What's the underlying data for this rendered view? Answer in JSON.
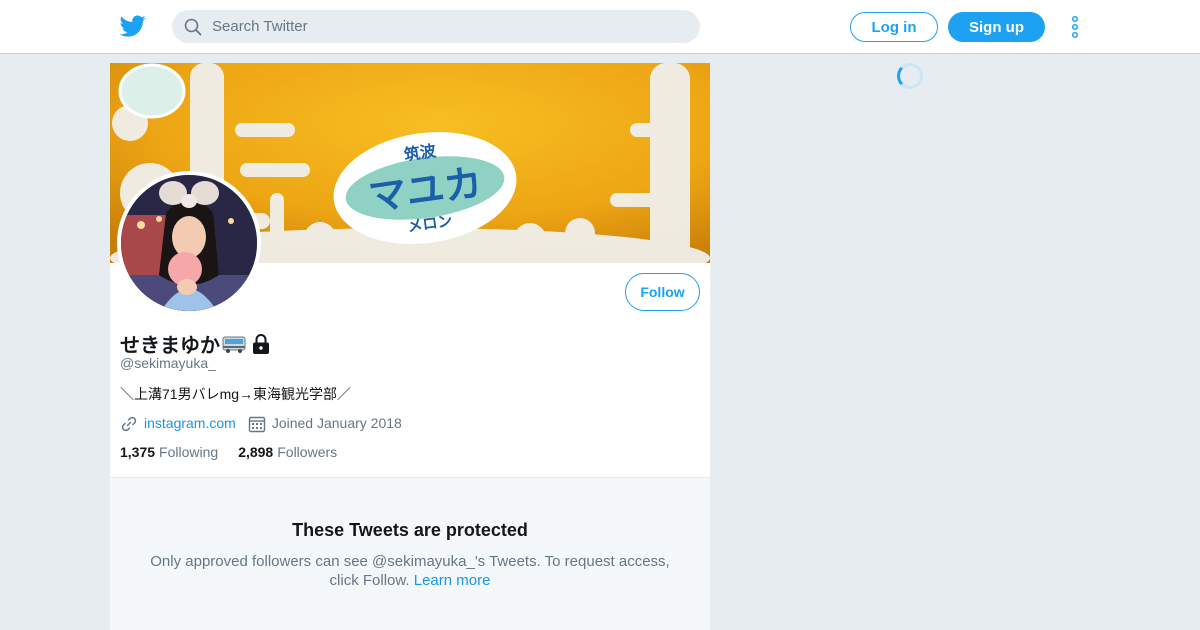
{
  "nav": {
    "search_placeholder": "Search Twitter",
    "login_label": "Log in",
    "signup_label": "Sign up"
  },
  "profile": {
    "display_name": "せきまゆか",
    "handle": "@sekimayuka_",
    "bio": "＼上溝71男バレmg→東海観光学部／",
    "website": "instagram.com",
    "joined": "Joined January 2018",
    "follow_label": "Follow",
    "stats": {
      "following_count": "1,375",
      "following_label": "Following",
      "followers_count": "2,898",
      "followers_label": "Followers"
    },
    "banner_label": {
      "top": "筑波",
      "main": "マユカ",
      "bottom": "メロン"
    }
  },
  "protected": {
    "title": "These Tweets are protected",
    "body_line1": "Only approved followers can see @sekimayuka_'s Tweets. To request access,",
    "body_line2_prefix": "click Follow.",
    "learn_more": "Learn more"
  },
  "colors": {
    "accent": "#1da1f2",
    "link": "#1b95e0",
    "page_bg": "#e6ecf0",
    "muted_text": "#657786"
  },
  "icons": [
    "twitter-bird-icon",
    "search-icon",
    "more-vertical-icon",
    "bus-emoji-icon",
    "lock-icon",
    "link-icon",
    "calendar-icon",
    "loading-spinner"
  ]
}
